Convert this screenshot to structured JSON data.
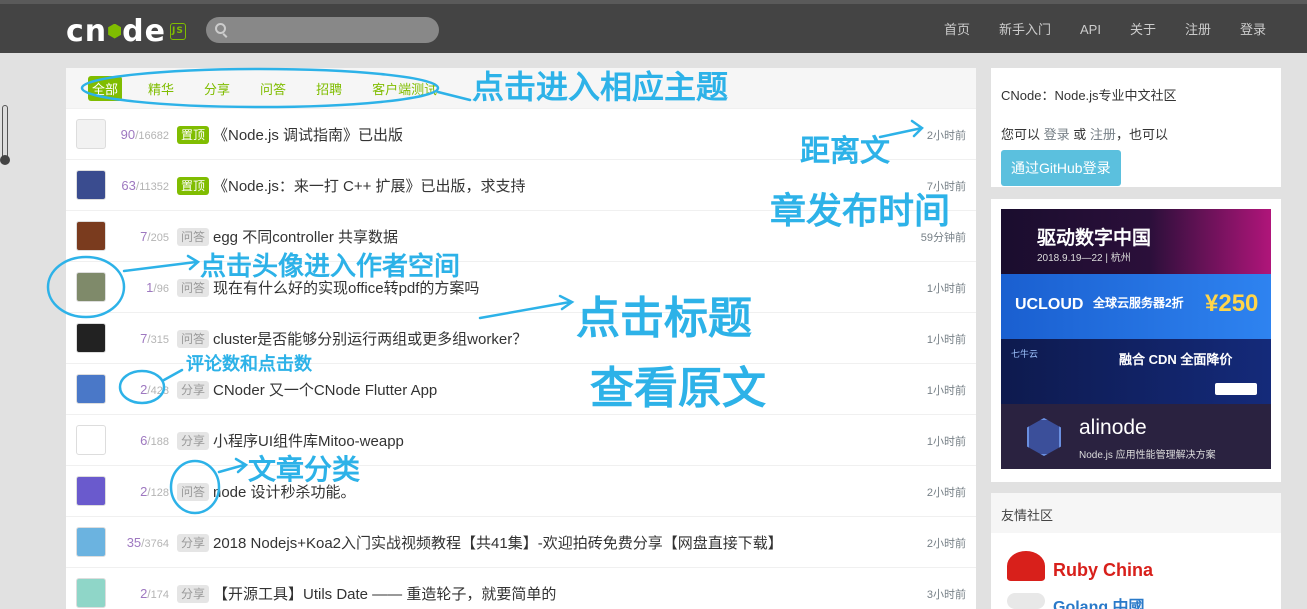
{
  "header": {
    "logo_text": "cnode",
    "logo_badge": "JS",
    "nav": [
      "首页",
      "新手入门",
      "API",
      "关于",
      "注册",
      "登录"
    ]
  },
  "tabs": [
    "全部",
    "精华",
    "分享",
    "问答",
    "招聘",
    "客户端测试"
  ],
  "active_tab": "全部",
  "topics": [
    {
      "replies": "90",
      "visits": "16682",
      "tag": "置顶",
      "tag_type": "top",
      "title": "《Node.js 调试指南》已出版",
      "time": "2小时前",
      "avatar_color": "#f2f2f2"
    },
    {
      "replies": "63",
      "visits": "11352",
      "tag": "置顶",
      "tag_type": "top",
      "title": "《Node.js：来一打 C++ 扩展》已出版，求支持",
      "time": "7小时前",
      "avatar_color": "#3a4c8f"
    },
    {
      "replies": "7",
      "visits": "205",
      "tag": "问答",
      "tag_type": "normal",
      "title": "egg 不同controller 共享数据",
      "time": "59分钟前",
      "avatar_color": "#7a3b1e"
    },
    {
      "replies": "1",
      "visits": "96",
      "tag": "问答",
      "tag_type": "normal",
      "title": "现在有什么好的实现office转pdf的方案吗",
      "time": "1小时前",
      "avatar_color": "#7f8a6a"
    },
    {
      "replies": "7",
      "visits": "315",
      "tag": "问答",
      "tag_type": "normal",
      "title": "cluster是否能够分别运行两组或更多组worker？",
      "time": "1小时前",
      "avatar_color": "#222222"
    },
    {
      "replies": "2",
      "visits": "428",
      "tag": "分享",
      "tag_type": "normal",
      "title": "CNoder 又一个CNode Flutter App",
      "time": "1小时前",
      "avatar_color": "#4a78c8"
    },
    {
      "replies": "6",
      "visits": "188",
      "tag": "分享",
      "tag_type": "normal",
      "title": "小程序UI组件库Mitoo-weapp",
      "time": "1小时前",
      "avatar_color": "#ffffff"
    },
    {
      "replies": "2",
      "visits": "128",
      "tag": "问答",
      "tag_type": "normal",
      "title": "node 设计秒杀功能。",
      "time": "2小时前",
      "avatar_color": "#6a5acd"
    },
    {
      "replies": "35",
      "visits": "3764",
      "tag": "分享",
      "tag_type": "normal",
      "title": "2018 Nodejs+Koa2入门实战视频教程【共41集】-欢迎拍砖免费分享【网盘直接下载】",
      "time": "2小时前",
      "avatar_color": "#6bb3e0"
    },
    {
      "replies": "2",
      "visits": "174",
      "tag": "分享",
      "tag_type": "normal",
      "title": "【开源工具】Utils Date —— 重造轮子，就要简单的",
      "time": "3小时前",
      "avatar_color": "#8fd6c8"
    }
  ],
  "sidebar": {
    "about_title": "CNode：Node.js专业中文社区",
    "login_prefix": "您可以",
    "login_link": "登录",
    "login_or": "或",
    "register_link": "注册",
    "login_suffix": "，也可以",
    "github_button": "通过GitHub登录",
    "ads": [
      {
        "title": "驱动数字中国",
        "sub": "2018.9.19—22 | 杭州"
      },
      {
        "title": "UCLOUD",
        "sub": "全球云服务器2折",
        "price": "¥250"
      },
      {
        "title": "融合 CDN 全面降价",
        "sub": "七牛云"
      },
      {
        "title": "alinode",
        "sub": "Node.js 应用性能管理解决方案"
      }
    ],
    "friends_title": "友情社区",
    "friends": [
      "Ruby China",
      "Golang 中國"
    ]
  },
  "annotations": {
    "tabs_note": "点击进入相应主题",
    "time_note_1": "距离文",
    "time_note_2": "章发布时间",
    "avatar_note": "点击头像进入作者空间",
    "title_note_1": "点击标题",
    "title_note_2": "查看原文",
    "count_note": "评论数和点击数",
    "tag_note": "文章分类"
  },
  "colors": {
    "brand_green": "#80bd01",
    "annotation_blue": "#2db2e8",
    "header_bg": "#444444",
    "github_button": "#5bc0de"
  }
}
